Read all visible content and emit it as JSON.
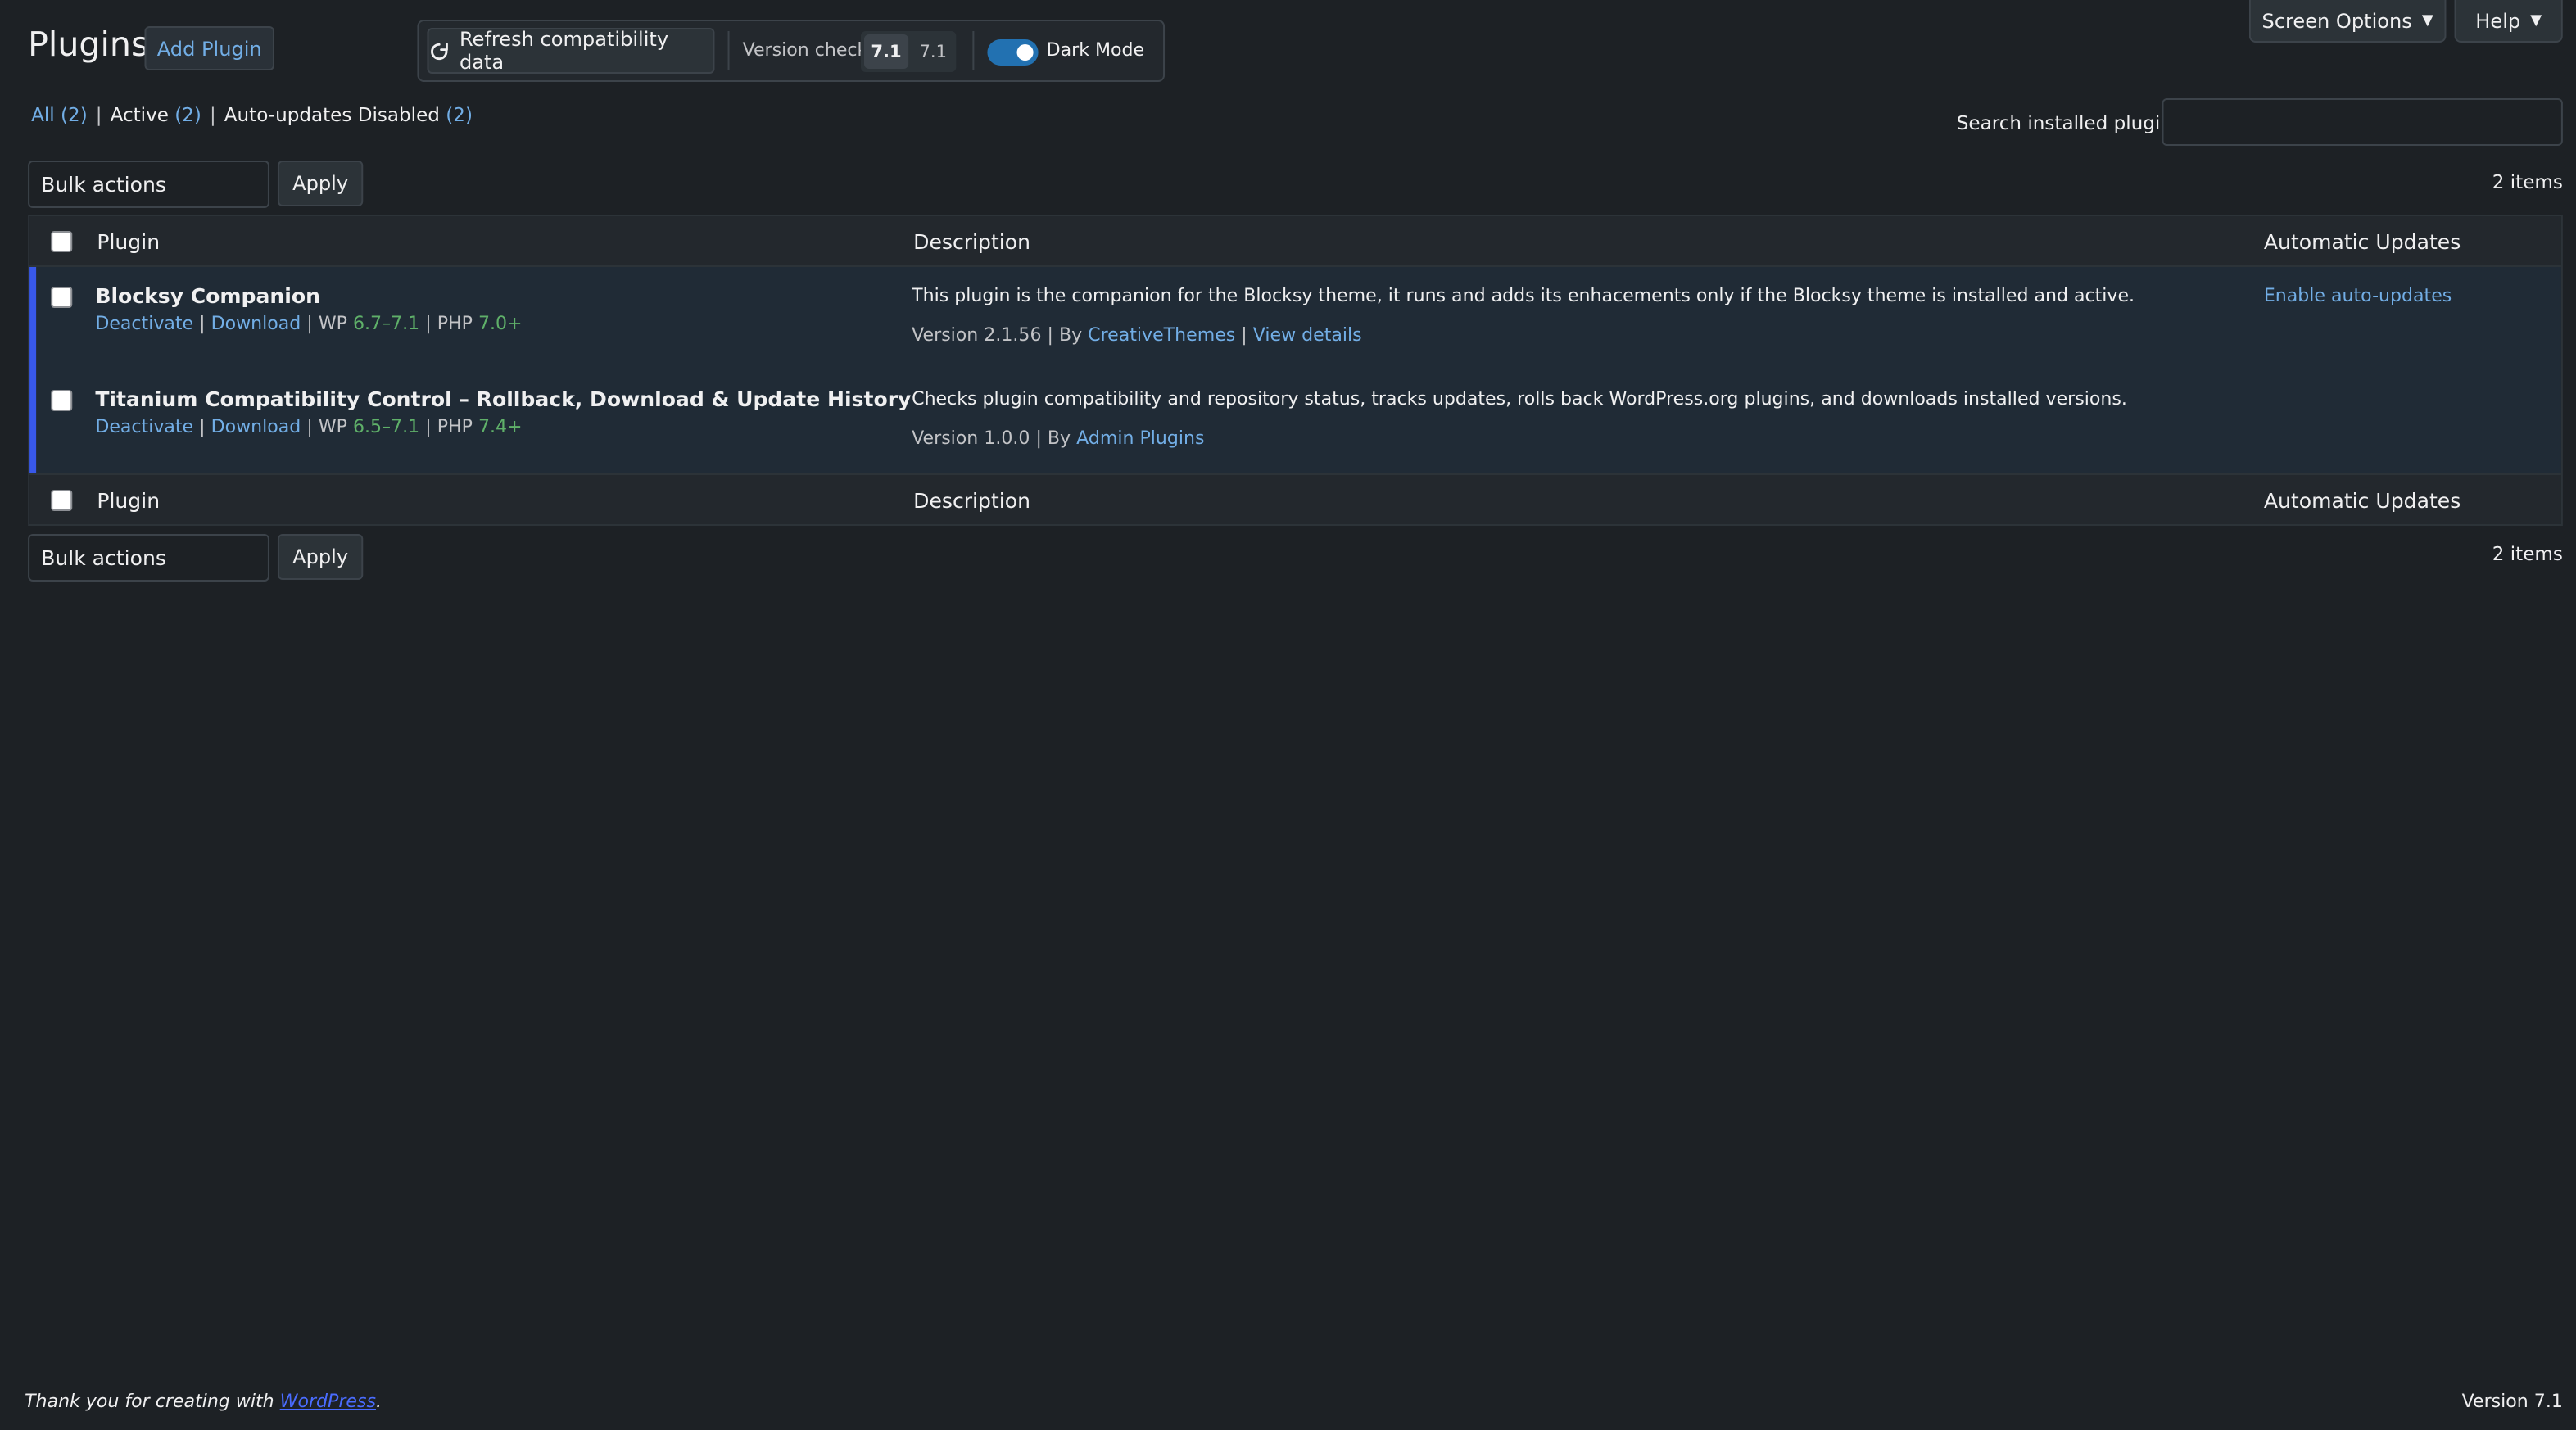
{
  "header": {
    "title": "Plugins",
    "add_plugin": "Add Plugin",
    "refresh": "Refresh compatibility data",
    "version_check_label": "Version check",
    "version_a": "7.1",
    "version_b": "7.1",
    "dark_mode_label": "Dark Mode",
    "dark_mode_on": true,
    "screen_options": "Screen Options",
    "help": "Help",
    "caret": "▼"
  },
  "filters": {
    "all_label": "All",
    "all_count": "(2)",
    "active_label": "Active",
    "active_count": "(2)",
    "autoupdates_label": "Auto-updates Disabled",
    "autoupdates_count": "(2)",
    "separator": "|"
  },
  "search": {
    "label": "Search installed plugins",
    "value": ""
  },
  "bulk": {
    "select_label": "Bulk actions",
    "apply": "Apply",
    "items": "2 items"
  },
  "table": {
    "columns": {
      "plugin": "Plugin",
      "description": "Description",
      "auto_updates": "Automatic Updates"
    },
    "rows": [
      {
        "name": "Blocksy Companion",
        "deactivate": "Deactivate",
        "sep1": "|",
        "download": "Download",
        "sep2": "|",
        "wp_label": "WP",
        "wp_range": "6.7–7.1",
        "sep3": "|",
        "php_label": "PHP",
        "php_min": "7.0+",
        "description": "This plugin is the companion for the Blocksy theme, it runs and adds its enhacements only if the Blocksy theme is installed and active.",
        "version": "Version 2.1.56",
        "by": "| By",
        "author": "CreativeThemes",
        "sep4": "|",
        "view_details": "View details",
        "auto_update_link": "Enable auto-updates"
      },
      {
        "name": "Titanium Compatibility Control – Rollback, Download & Update History",
        "deactivate": "Deactivate",
        "sep1": "|",
        "download": "Download",
        "sep2": "|",
        "wp_label": "WP",
        "wp_range": "6.5–7.1",
        "sep3": "|",
        "php_label": "PHP",
        "php_min": "7.4+",
        "description": "Checks plugin compatibility and repository status, tracks updates, rolls back WordPress.org plugins, and downloads installed versions.",
        "version": "Version 1.0.0",
        "by": "| By",
        "author": "Admin Plugins"
      }
    ]
  },
  "footer": {
    "thanks_prefix": "Thank you for creating with",
    "wordpress": "WordPress",
    "thanks_suffix": ".",
    "version": "Version 7.1"
  },
  "colors": {
    "background": "#1d2125",
    "link": "#72aee6",
    "accent": "#2271b1",
    "active_row_border": "#3858e9",
    "compat_ok": "#5fb069"
  }
}
